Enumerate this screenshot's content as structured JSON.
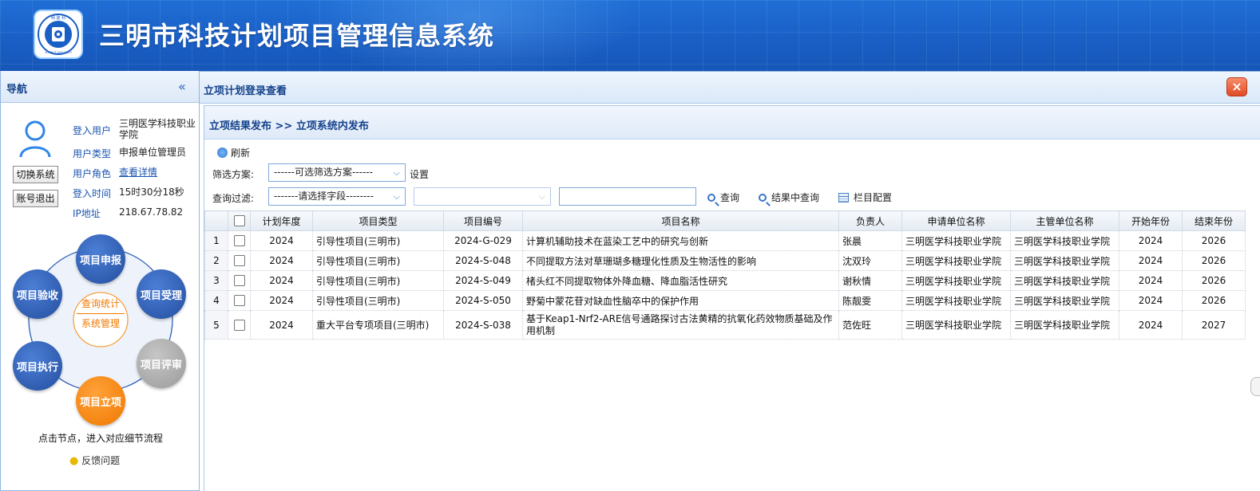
{
  "header": {
    "title": "三明市科技计划项目管理信息系统",
    "logo_top_text": "明 建 科",
    "logo_bottom_text": "SCIENCE AND TECH"
  },
  "sidebar": {
    "title": "导航",
    "collapse_glyph": "«",
    "switch_system": "切换系统",
    "logout": "账号退出",
    "user_info": [
      {
        "label": "登入用户",
        "value": "三明医学科技职业学院"
      },
      {
        "label": "用户类型",
        "value": "申报单位管理员"
      },
      {
        "label": "用户角色",
        "value": "查看详情"
      },
      {
        "label": "登入时间",
        "value": "15时30分18秒"
      },
      {
        "label": "IP地址",
        "value": "218.67.78.82"
      }
    ],
    "flow": {
      "nodes": [
        "项目申报",
        "项目受理",
        "项目评审",
        "项目立项",
        "项目执行",
        "项目验收"
      ],
      "center_top": "查询统计",
      "center_bottom": "系统管理"
    },
    "hint": "点击节点，进入对应细节流程",
    "feedback": "反馈问题"
  },
  "main": {
    "title": "立项计划登录查看",
    "close_glyph": "×",
    "breadcrumb": "立项结果发布 >> 立项系统内发布",
    "toolbar": {
      "refresh": "刷新",
      "filter_label": "筛选方案:",
      "filter_placeholder": "------可选筛选方案------",
      "settings": "设置",
      "query_label": "查询过滤:",
      "field_placeholder": "-------请选择字段--------",
      "query": "查询",
      "result_query": "结果中查询",
      "column_config": "栏目配置"
    },
    "table": {
      "columns": [
        "计划年度",
        "项目类型",
        "项目编号",
        "项目名称",
        "负责人",
        "申请单位名称",
        "主管单位名称",
        "开始年份",
        "结束年份"
      ],
      "rows": [
        {
          "n": "1",
          "year": "2024",
          "type": "引导性项目(三明市)",
          "code": "2024-G-029",
          "name": "计算机辅助技术在蓝染工艺中的研究与创新",
          "leader": "张晨",
          "applicant": "三明医学科技职业学院",
          "supervisor": "三明医学科技职业学院",
          "start": "2024",
          "end": "2026"
        },
        {
          "n": "2",
          "year": "2024",
          "type": "引导性项目(三明市)",
          "code": "2024-S-048",
          "name": "不同提取方法对草珊瑚多糖理化性质及生物活性的影响",
          "leader": "沈双玲",
          "applicant": "三明医学科技职业学院",
          "supervisor": "三明医学科技职业学院",
          "start": "2024",
          "end": "2026"
        },
        {
          "n": "3",
          "year": "2024",
          "type": "引导性项目(三明市)",
          "code": "2024-S-049",
          "name": "楮头红不同提取物体外降血糖、降血脂活性研究",
          "leader": "谢秋情",
          "applicant": "三明医学科技职业学院",
          "supervisor": "三明医学科技职业学院",
          "start": "2024",
          "end": "2026"
        },
        {
          "n": "4",
          "year": "2024",
          "type": "引导性项目(三明市)",
          "code": "2024-S-050",
          "name": "野菊中蒙花苷对缺血性脑卒中的保护作用",
          "leader": "陈靓雯",
          "applicant": "三明医学科技职业学院",
          "supervisor": "三明医学科技职业学院",
          "start": "2024",
          "end": "2026"
        },
        {
          "n": "5",
          "year": "2024",
          "type": "重大平台专项项目(三明市)",
          "code": "2024-S-038",
          "name": "基于Keap1-Nrf2-ARE信号通路探讨古法黄精的抗氧化药效物质基础及作用机制",
          "leader": "范佐旺",
          "applicant": "三明医学科技职业学院",
          "supervisor": "三明医学科技职业学院",
          "start": "2024",
          "end": "2027"
        }
      ]
    }
  },
  "colors": {
    "header_blue": "#1a5fc6",
    "link_blue": "#1b55b0",
    "title_navy": "#15428b",
    "node_blue": "#2f5fb8",
    "node_gray": "#a8a8a8",
    "node_orange": "#f58a12",
    "close_red": "#e4532f"
  }
}
